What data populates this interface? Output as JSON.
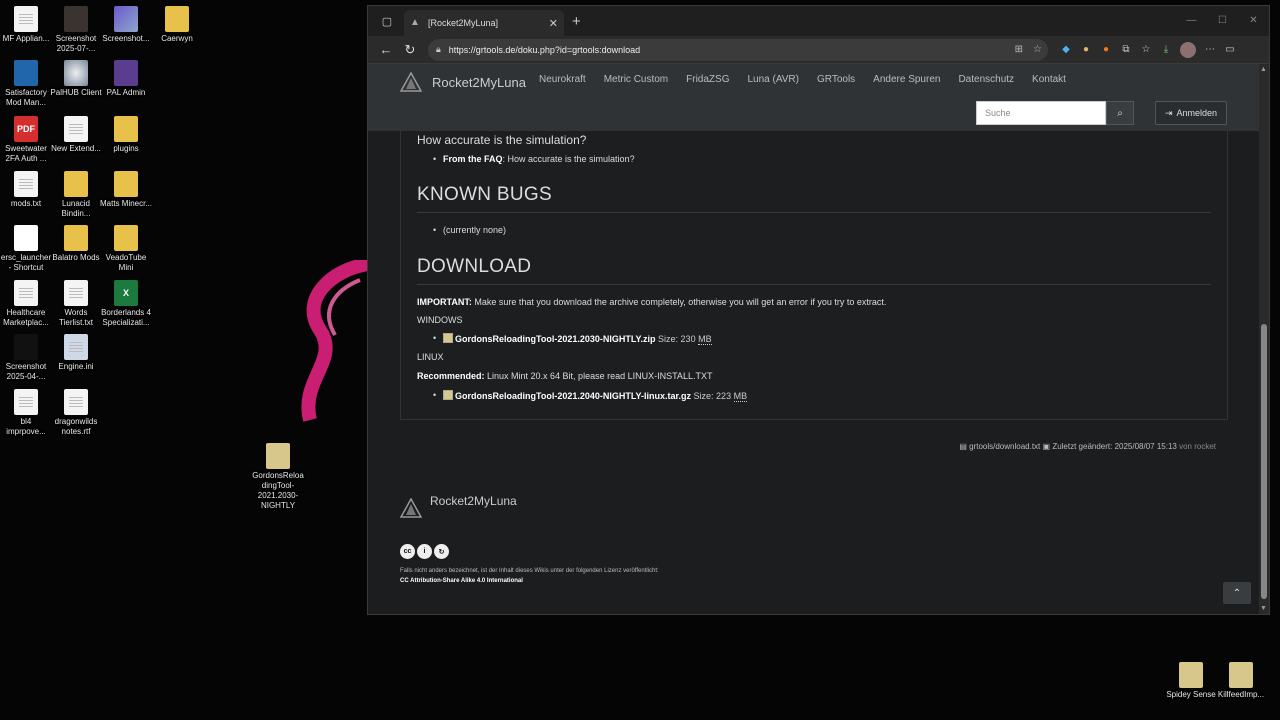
{
  "desktop": {
    "icons": [
      {
        "label": "MF Applian...",
        "icon": "document-icon"
      },
      {
        "label": "Screenshot 2025-07-...",
        "icon": "image-icon"
      },
      {
        "label": "Screenshot...",
        "icon": "image-icon"
      },
      {
        "label": "Caerwyn",
        "icon": "folder-icon"
      },
      {
        "label": "Satisfactory Mod Man...",
        "icon": "app-icon"
      },
      {
        "label": "PalHUB Client",
        "icon": "app-icon"
      },
      {
        "label": "PAL Admin",
        "icon": "app-icon"
      },
      {
        "label": "Sweetwater 2FA Auth ...",
        "icon": "pdf-icon"
      },
      {
        "label": "New Extend...",
        "icon": "document-icon"
      },
      {
        "label": "plugins",
        "icon": "folder-icon"
      },
      {
        "label": "mods.txt",
        "icon": "document-icon"
      },
      {
        "label": "Lunacid Bindin...",
        "icon": "folder-icon"
      },
      {
        "label": "Matts Minecr...",
        "icon": "folder-icon"
      },
      {
        "label": "ersc_launcher - Shortcut",
        "icon": "app-icon"
      },
      {
        "label": "Balatro Mods",
        "icon": "folder-icon"
      },
      {
        "label": "VeadoTube Mini",
        "icon": "folder-icon"
      },
      {
        "label": "Healthcare Marketplac...",
        "icon": "document-icon"
      },
      {
        "label": "Words Tierlist.txt",
        "icon": "document-icon"
      },
      {
        "label": "Borderlands 4 Specializati...",
        "icon": "excel-icon"
      },
      {
        "label": "Screenshot 2025-04-...",
        "icon": "image-icon"
      },
      {
        "label": "Engine.ini",
        "icon": "config-icon"
      },
      {
        "label": "bl4 imprpove...",
        "icon": "document-icon"
      },
      {
        "label": "dragonwilds notes.rtf",
        "icon": "document-icon"
      },
      {
        "label": "GordonsReloadingTool-2021.2030-NIGHTLY",
        "icon": "zip-icon"
      },
      {
        "label": "Spidey Sense",
        "icon": "zip-icon"
      },
      {
        "label": "KillfeedImp...",
        "icon": "zip-icon"
      }
    ]
  },
  "browser": {
    "tab_title": "[Rocket2MyLuna]",
    "url": "https://grtools.de/doku.php?id=grtools:download"
  },
  "site": {
    "brand": "Rocket2MyLuna",
    "menu": [
      "Neurokraft",
      "Metric Custom",
      "FridaZSG",
      "Luna (AVR)",
      "GRTools",
      "Andere Spuren",
      "Datenschutz",
      "Kontakt"
    ],
    "search_placeholder": "Suche",
    "login_label": "Anmelden"
  },
  "content": {
    "accuracy_heading": "How accurate is the simulation?",
    "faq_prefix": "From the FAQ",
    "faq_text": ": How accurate is the simulation?",
    "bugs_heading": "KNOWN BUGS",
    "bugs_item": "(currently none)",
    "download_heading": "DOWNLOAD",
    "important_label": "IMPORTANT:",
    "important_text": " Make sure that you download the archive completely, otherwise you will get an error if you try to extract.",
    "windows_label": "WINDOWS",
    "windows_file": "GordonsReloadingTool-2021.2030-NIGHTLY.zip",
    "windows_size": " Size: 230 ",
    "unit": "MB",
    "linux_label": "LINUX",
    "recommended_label": "Recommended:",
    "recommended_text": " Linux Mint 20.x 64 Bit, please read LINUX-INSTALL.TXT",
    "linux_file": "GordonsReloadingTool-2021.2040-NIGHTLY-linux.tar.gz",
    "linux_size": " Size: 223 "
  },
  "docinfo": {
    "file": "grtools/download.txt",
    "changed": "Zuletzt geändert: 2025/08/07 15:13",
    "by": "von rocket"
  },
  "footer": {
    "brand": "Rocket2MyLuna",
    "license_text": "Falls nicht anders bezeichnet, ist der Inhalt dieses Wikis unter der folgenden Lizenz veröffentlicht:",
    "license_link": "CC Attribution-Share Alike 4.0 International"
  }
}
